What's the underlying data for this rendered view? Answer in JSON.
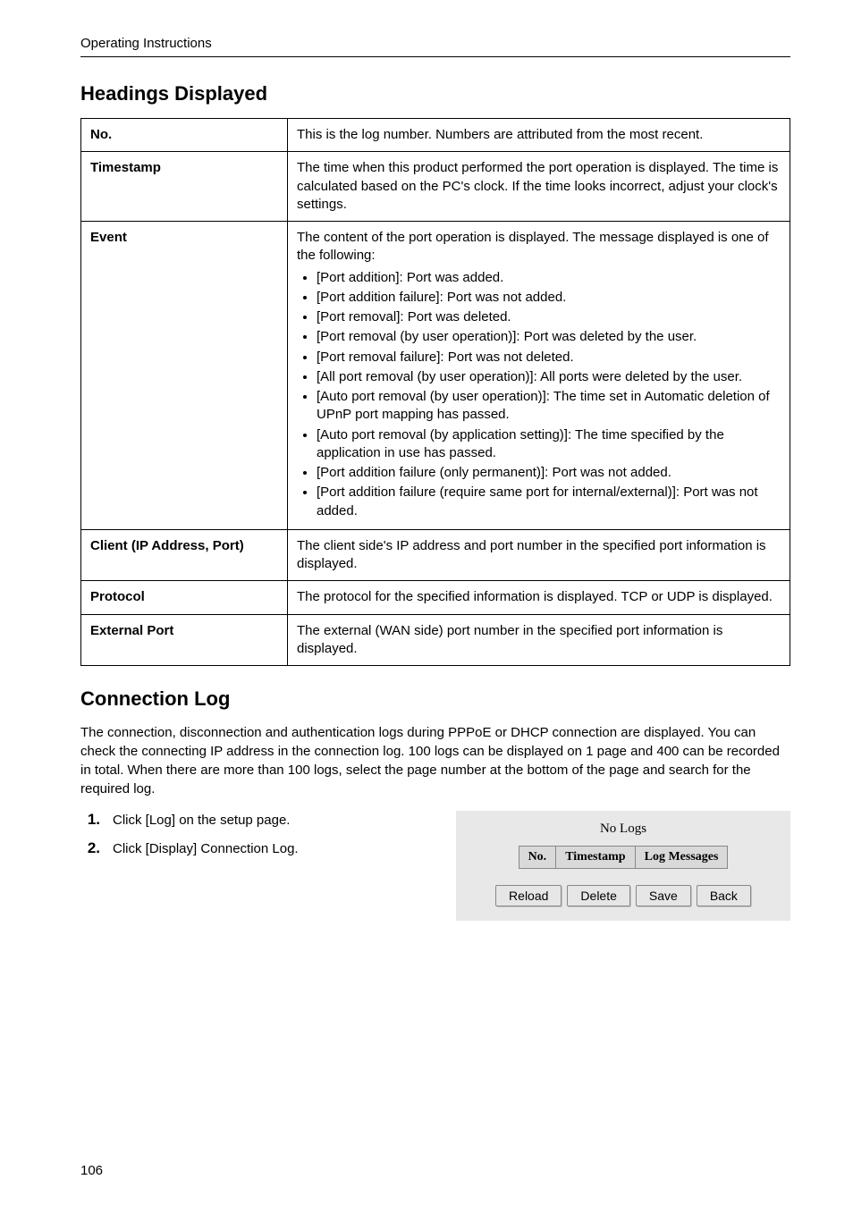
{
  "running_head": "Operating Instructions",
  "section1_title": "Headings Displayed",
  "defs": [
    {
      "key": "No.",
      "value_lead": "This is the log number. Numbers are attributed from the most recent."
    },
    {
      "key": "Timestamp",
      "value_lead": "The time when this product performed the port operation is displayed. The time is calculated based on the PC's clock. If the time looks incorrect, adjust your clock's settings."
    },
    {
      "key": "Event",
      "value_lead": "The content of the port operation is displayed. The message displayed is one of the following:",
      "bullets": [
        "[Port addition]: Port was added.",
        "[Port addition failure]: Port was not added.",
        "[Port removal]: Port was deleted.",
        "[Port removal (by user operation)]: Port was deleted by the user.",
        "[Port removal failure]: Port was not deleted.",
        "[All port removal (by user operation)]: All ports were deleted by the user.",
        "[Auto port removal (by user operation)]: The time set in Automatic deletion of UPnP port mapping has passed.",
        "[Auto port removal (by application setting)]: The time specified by the application in use has passed.",
        "[Port addition failure (only permanent)]: Port was not added.",
        "[Port addition failure (require same port for internal/external)]: Port was not added."
      ]
    },
    {
      "key": "Client (IP Address, Port)",
      "value_lead": "The client side's IP address and port number in the specified port information is displayed."
    },
    {
      "key": "Protocol",
      "value_lead": "The protocol for the specified information is displayed. TCP or UDP is displayed."
    },
    {
      "key": "External Port",
      "value_lead": "The external (WAN side) port number in the specified port information is displayed."
    }
  ],
  "section2_title": "Connection Log",
  "section2_body": "The connection, disconnection and authentication logs during PPPoE or DHCP connection are displayed. You can check the connecting IP address in the connection log. 100 logs can be displayed on 1 page and 400 can be recorded in total. When there are more than 100 logs, select the page number at the bottom of the page and search for the required log.",
  "steps": [
    "Click [Log] on the setup page.",
    "Click [Display] Connection Log."
  ],
  "widget": {
    "no_logs": "No Logs",
    "headers": {
      "no": "No.",
      "timestamp": "Timestamp",
      "log_messages": "Log Messages"
    },
    "buttons": {
      "reload": "Reload",
      "delete": "Delete",
      "save": "Save",
      "back": "Back"
    }
  },
  "page_number": "106"
}
